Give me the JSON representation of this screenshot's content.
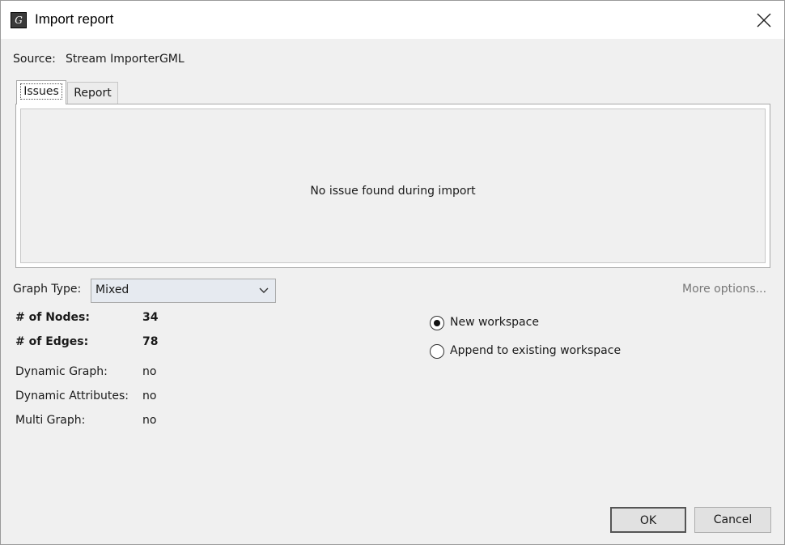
{
  "window": {
    "title": "Import report",
    "icon": "gephi-logo-icon"
  },
  "source": {
    "label": "Source:",
    "value": "Stream ImporterGML"
  },
  "tabs": [
    {
      "label": "Issues",
      "selected": true
    },
    {
      "label": "Report",
      "selected": false
    }
  ],
  "issues": {
    "message": "No issue found during import"
  },
  "graph_type": {
    "label": "Graph Type:",
    "selected": "Mixed"
  },
  "more_options": "More options...",
  "stats": {
    "nodes_label": "# of Nodes:",
    "nodes_value": "34",
    "edges_label": "# of Edges:",
    "edges_value": "78",
    "dynamic_graph_label": "Dynamic Graph:",
    "dynamic_graph_value": "no",
    "dynamic_attributes_label": "Dynamic Attributes:",
    "dynamic_attributes_value": "no",
    "multi_graph_label": "Multi Graph:",
    "multi_graph_value": "no"
  },
  "workspace": {
    "options": [
      {
        "label": "New workspace",
        "selected": true
      },
      {
        "label": "Append to existing workspace",
        "selected": false
      }
    ]
  },
  "buttons": {
    "ok": "OK",
    "cancel": "Cancel"
  }
}
